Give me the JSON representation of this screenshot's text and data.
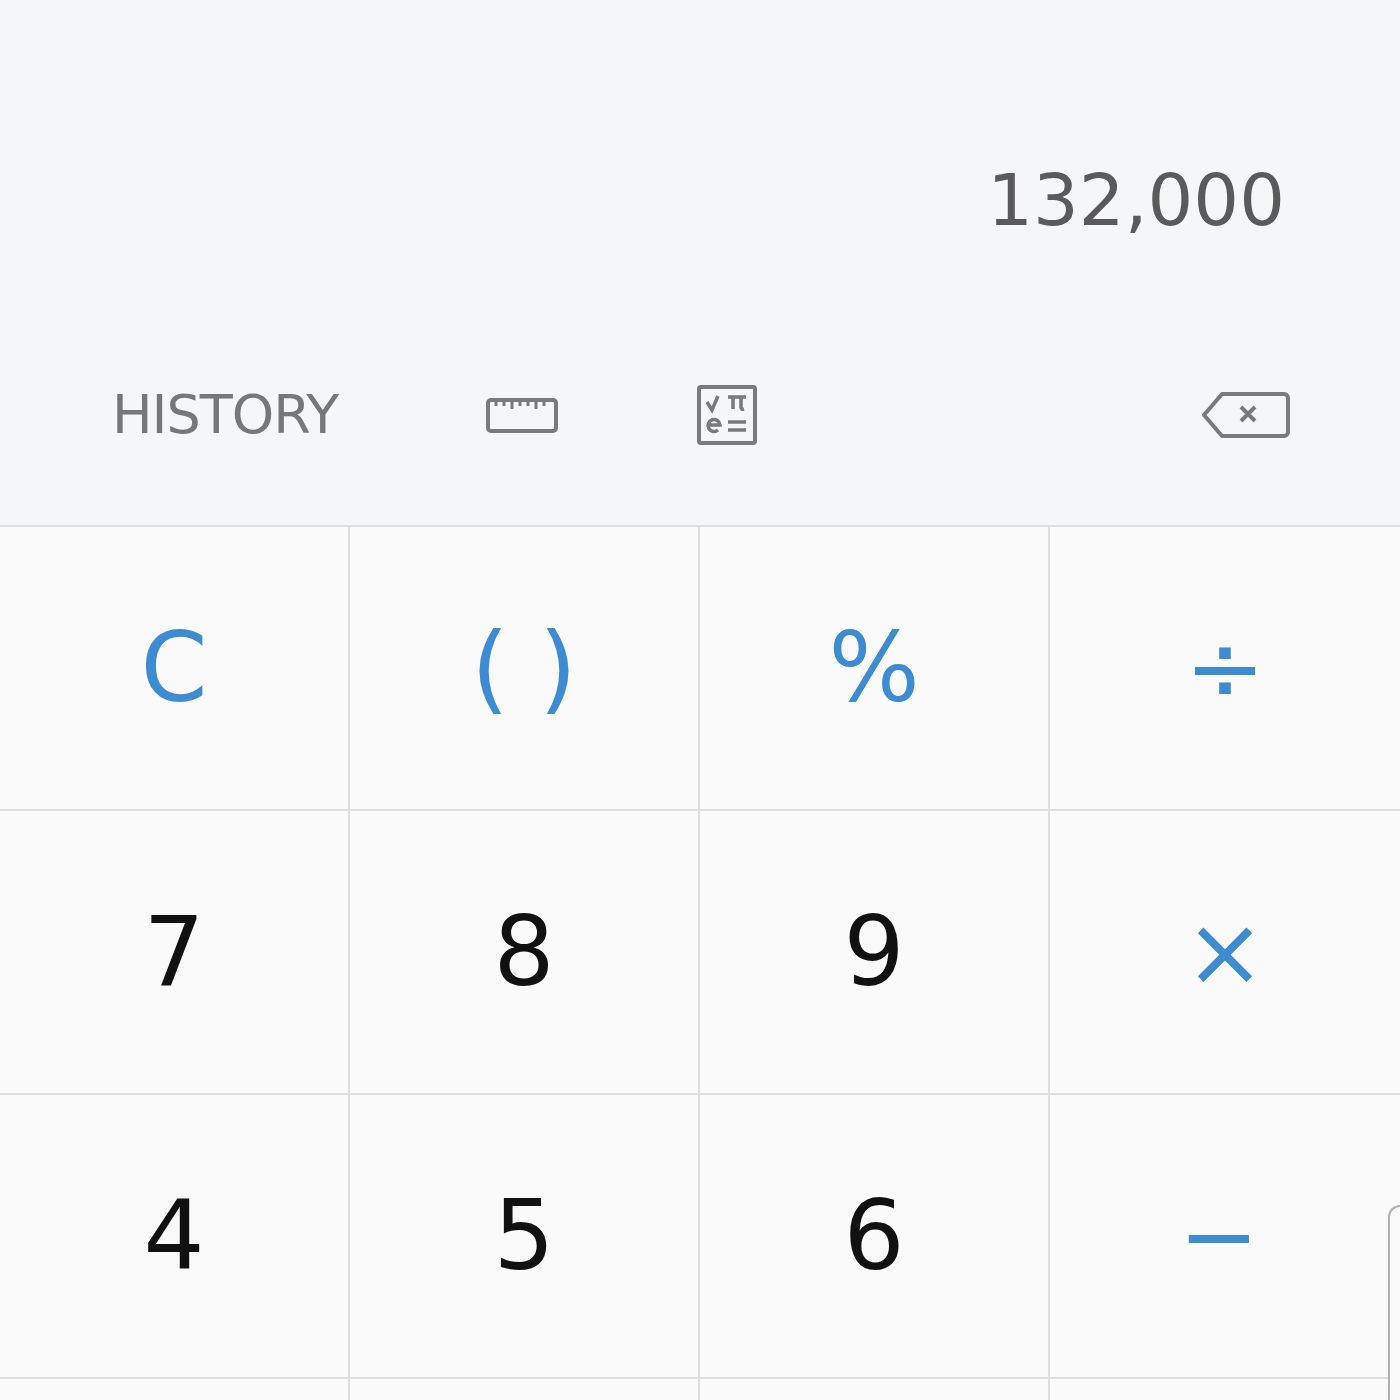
{
  "display": {
    "value": "132,000"
  },
  "toolbar": {
    "history": "HISTORY"
  },
  "keys": [
    {
      "label": "C",
      "kind": "operator"
    },
    {
      "label": "( )",
      "kind": "operator"
    },
    {
      "label": "%",
      "kind": "operator"
    },
    {
      "label": "÷",
      "kind": "operator"
    },
    {
      "label": "7",
      "kind": "digit"
    },
    {
      "label": "8",
      "kind": "digit"
    },
    {
      "label": "9",
      "kind": "digit"
    },
    {
      "label": "×",
      "kind": "operator"
    },
    {
      "label": "4",
      "kind": "digit"
    },
    {
      "label": "5",
      "kind": "digit"
    },
    {
      "label": "6",
      "kind": "digit"
    },
    {
      "label": "−",
      "kind": "operator"
    }
  ]
}
